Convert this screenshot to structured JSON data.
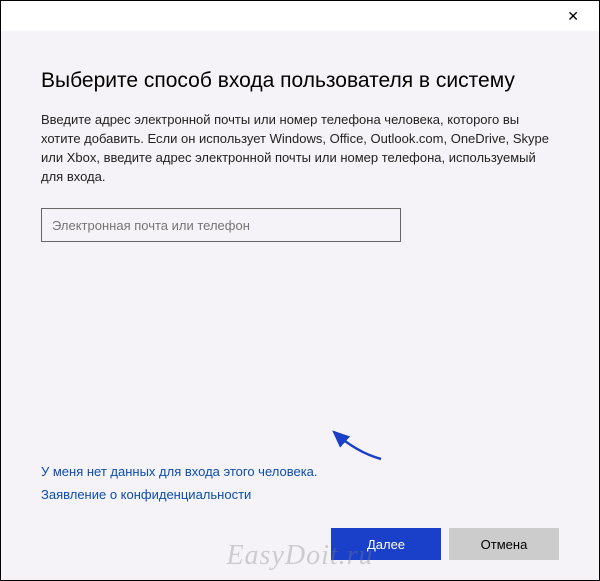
{
  "titlebar": {
    "close": "✕"
  },
  "dialog": {
    "heading": "Выберите способ входа пользователя в систему",
    "description": "Введите адрес электронной почты или номер телефона человека, которого вы хотите добавить. Если он использует Windows, Office, Outlook.com, OneDrive, Skype или Xbox, введите адрес электронной почты или номер телефона, используемый для входа.",
    "input_placeholder": "Электронная почта или телефон",
    "links": {
      "no_credentials": "У меня нет данных для входа этого человека.",
      "privacy": "Заявление о конфиденциальности"
    },
    "buttons": {
      "next": "Далее",
      "cancel": "Отмена"
    }
  },
  "watermark": "EasyDoit.ru"
}
